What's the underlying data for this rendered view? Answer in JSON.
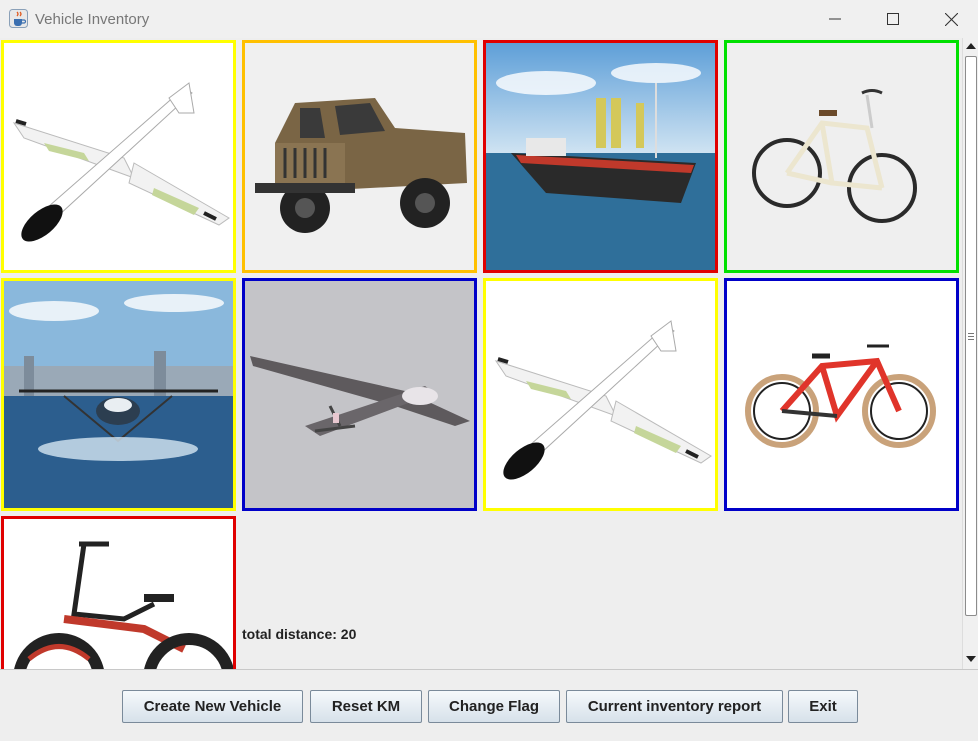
{
  "window": {
    "title": "Vehicle Inventory",
    "app_icon": "java-cup-icon",
    "controls": [
      "minimize-icon",
      "maximize-icon",
      "close-icon"
    ]
  },
  "inventory": {
    "tiles": [
      {
        "subject": "glider-plane",
        "flag_color": "#ffff00"
      },
      {
        "subject": "pickup-jeep",
        "flag_color": "#ffc000"
      },
      {
        "subject": "cargo-ship",
        "flag_color": "#e00000"
      },
      {
        "subject": "city-bicycle",
        "flag_color": "#00e000"
      },
      {
        "subject": "hydrofoil-seaplane",
        "flag_color": "#ffff00"
      },
      {
        "subject": "drone-plane",
        "flag_color": "#0000c8"
      },
      {
        "subject": "glider-plane",
        "flag_color": "#ffff00"
      },
      {
        "subject": "mountain-bike",
        "flag_color": "#0000c8"
      },
      {
        "subject": "electric-bike",
        "flag_color": "#e00000"
      }
    ],
    "total_distance_label": "total distance: 20"
  },
  "buttons": {
    "create": "Create New Vehicle",
    "reset": "Reset KM",
    "flag": "Change Flag",
    "report": "Current inventory report",
    "exit": "Exit"
  }
}
